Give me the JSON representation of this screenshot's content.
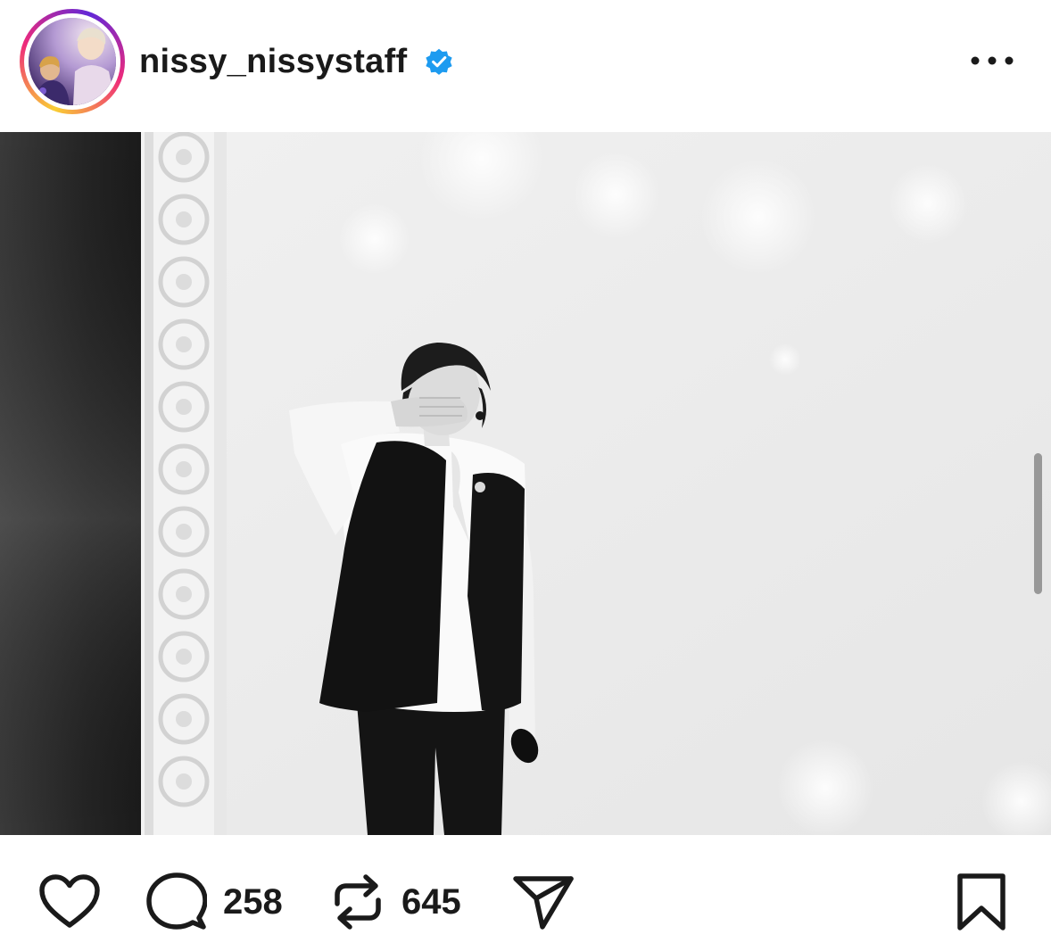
{
  "header": {
    "username": "nissy_nissystaff",
    "verified": true,
    "avatar_icon": "profile-avatar",
    "more_icon": "more-horizontal-icon",
    "story_ring_colors": [
      "#f9ce34",
      "#ee2a7b",
      "#6228d7"
    ]
  },
  "photo": {
    "style": "black-and-white",
    "scrollbar": "visible"
  },
  "actions": {
    "like": {
      "icon": "heart-icon"
    },
    "comment": {
      "icon": "comment-icon",
      "count": "258"
    },
    "repost": {
      "icon": "repost-icon",
      "count": "645"
    },
    "share": {
      "icon": "send-icon"
    },
    "save": {
      "icon": "bookmark-icon"
    }
  },
  "colors": {
    "text": "#1a1a1a",
    "verified_badge": "#1d9bf0",
    "background": "#ffffff"
  }
}
